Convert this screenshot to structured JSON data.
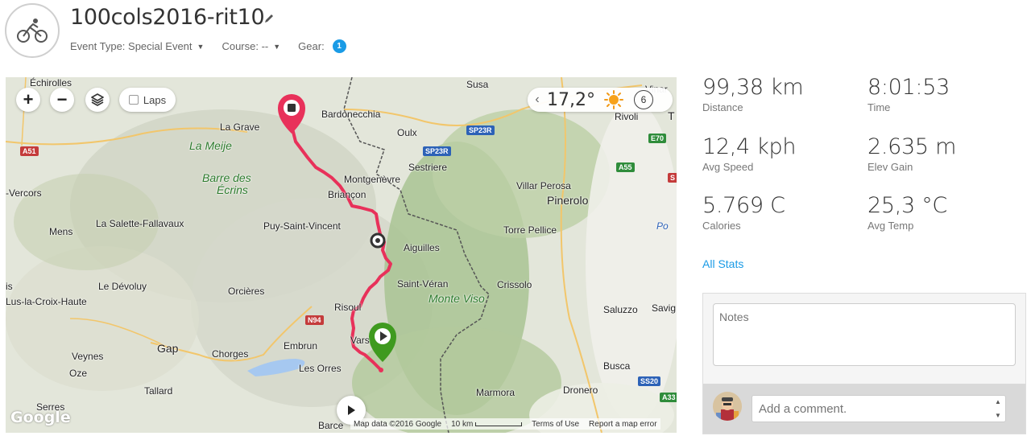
{
  "header": {
    "title": "100cols2016-rit10",
    "activity_icon": "bicycle-icon",
    "event_type_label": "Event Type: Special Event",
    "course_label": "Course: --",
    "gear_label": "Gear:",
    "gear_count": "1"
  },
  "map": {
    "controls": {
      "zoom_in": "+",
      "zoom_out": "−",
      "laps_label": "Laps"
    },
    "weather": {
      "temperature": "17,2°",
      "wind": "6"
    },
    "labels": {
      "echirolles": "Échirolles",
      "susa": "Susa",
      "bardonecchia": "Bardonecchia",
      "la_grave": "La Grave",
      "oulx": "Oulx",
      "la_meije": "La Meije",
      "sestriere": "Sestriere",
      "barre_des_ecrins_1": "Barre des",
      "barre_des_ecrins_2": "Écrins",
      "montgenevre": "Montgenèvre",
      "villar_perosa": "Villar Perosa",
      "vercors": "-Vercors",
      "briancon": "Briançon",
      "pinerolo": "Pinerolo",
      "la_salette": "La Salette-Fallavaux",
      "puy_saint_vincent": "Puy-Saint-Vincent",
      "mens": "Mens",
      "torre_pellice": "Torre Pellice",
      "aiguilles": "Aiguilles",
      "le_devoluy": "Le Dévoluy",
      "saint_veran": "Saint-Véran",
      "crissolo": "Crissolo",
      "lus_la_croix": "Lus-la-Croix-Haute",
      "orcieres": "Orcières",
      "monte_viso": "Monte Viso",
      "risoul": "Risoul",
      "saluzzo": "Saluzzo",
      "savig": "Savig",
      "gap": "Gap",
      "chorges": "Chorges",
      "embrun": "Embrun",
      "vars": "Vars",
      "veynes": "Veynes",
      "oze": "Oze",
      "les_orres": "Les Orres",
      "busca": "Busca",
      "tallard": "Tallard",
      "marmora": "Marmora",
      "dronero": "Dronero",
      "serres": "Serres",
      "barce": "Barce",
      "rivoli": "Rivoli",
      "po": "Po",
      "is": "is",
      "vinar": "Vinar",
      "t": "T"
    },
    "roads": {
      "a51": "A51",
      "sp23r_1": "SP23R",
      "sp23r_2": "SP23R",
      "e70": "E70",
      "a55": "A55",
      "n94": "N94",
      "ss20": "SS20",
      "a33": "A33",
      "s_right": "S"
    },
    "footer": {
      "map_data": "Map data ©2016 Google",
      "scale": "10 km",
      "terms": "Terms of Use",
      "report": "Report a map error"
    },
    "google_logo": "Google"
  },
  "stats": {
    "distance": {
      "value": "99,38 km",
      "label": "Distance"
    },
    "time": {
      "value": "8:01:53",
      "label": "Time"
    },
    "avg_speed": {
      "value": "12,4 kph",
      "label": "Avg Speed"
    },
    "elev_gain": {
      "value": "2.635 m",
      "label": "Elev Gain"
    },
    "calories": {
      "value": "5.769 C",
      "label": "Calories"
    },
    "avg_temp": {
      "value": "25,3 °C",
      "label": "Avg Temp"
    },
    "all_stats_link": "All Stats"
  },
  "notes": {
    "placeholder": "Notes",
    "comment_placeholder": "Add a comment."
  },
  "colors": {
    "accent": "#1a9be6",
    "route": "#e8315a",
    "end_marker": "#e8315a",
    "start_marker": "#3f9a1f"
  }
}
